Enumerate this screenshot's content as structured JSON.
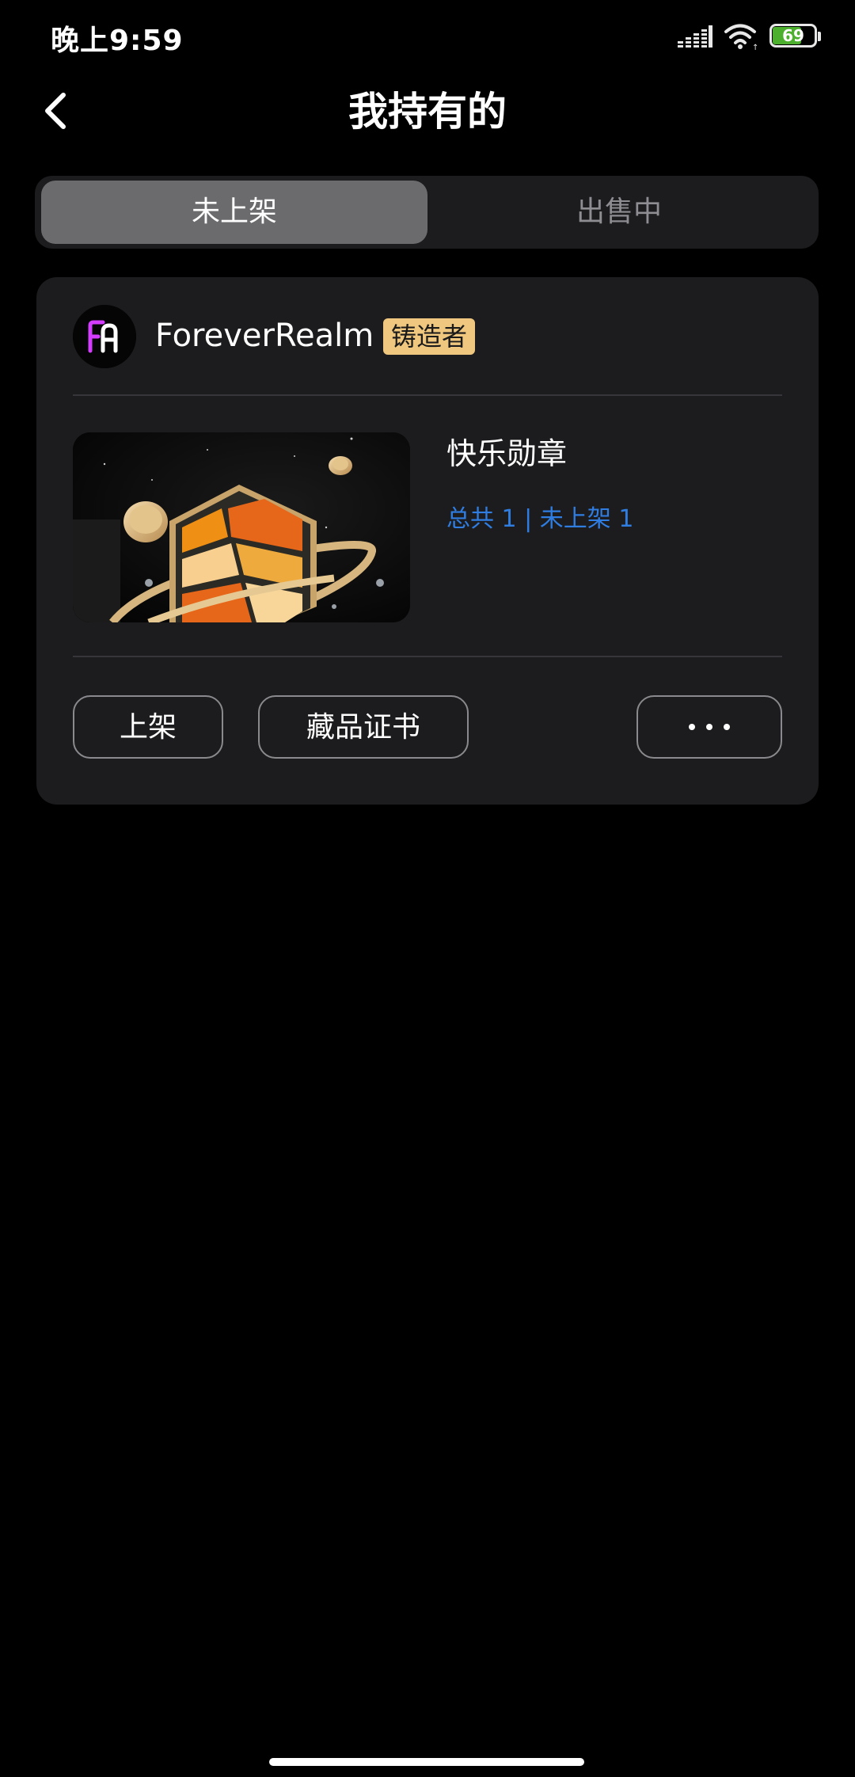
{
  "status_bar": {
    "time": "晚上9:59",
    "battery_level": "69",
    "icons": [
      "signal-icon",
      "wifi-icon",
      "battery-icon"
    ]
  },
  "header": {
    "title": "我持有的",
    "back_icon": "chevron-left-icon"
  },
  "tabs": [
    {
      "label": "未上架",
      "active": true
    },
    {
      "label": "出售中",
      "active": false
    }
  ],
  "collection_card": {
    "creator": {
      "name": "ForeverRealm",
      "badge": "铸造者",
      "avatar_icon": "forever-realm-logo-icon"
    },
    "item": {
      "title": "快乐勋章",
      "count_text": "总共 1 | 未上架 1"
    },
    "actions": {
      "list_label": "上架",
      "certificate_label": "藏品证书",
      "more_icon": "more-dots-icon"
    }
  },
  "colors": {
    "background": "#000000",
    "card": "#1c1c1e",
    "active_tab": "#6b6b6e",
    "badge": "#efc77f",
    "link_blue": "#2f7de1"
  }
}
